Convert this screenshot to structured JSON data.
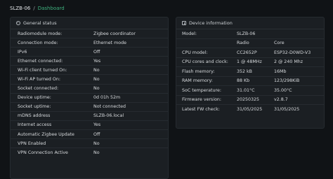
{
  "breadcrumb": {
    "home": "SLZB-06",
    "separator": "/",
    "current": "Dashboard"
  },
  "status_card": {
    "title": "General status",
    "rows": [
      {
        "key": "Radiomodule mode:",
        "value": "Zigbee coordinator"
      },
      {
        "key": "Connection mode:",
        "value": "Ethernet mode"
      },
      {
        "key": "IPv6",
        "value": "Off"
      },
      {
        "key": "Ethernet connected:",
        "value": "Yes"
      },
      {
        "key": "Wi-Fi client turned On:",
        "value": "No"
      },
      {
        "key": "Wi-Fi AP turned On:",
        "value": "No"
      },
      {
        "key": "Socket connected:",
        "value": "No"
      },
      {
        "key": "Device uptime:",
        "value": "0d 01h 52m"
      },
      {
        "key": "Socket uptime:",
        "value": "Not connected"
      },
      {
        "key": "mDNS address",
        "value": "SLZB-06.local"
      },
      {
        "key": "Internet access",
        "value": "Yes"
      },
      {
        "key": "Automatic Zigbee Update",
        "value": "Off"
      },
      {
        "key": "VPN Enabled",
        "value": "No"
      },
      {
        "key": "VPN Connection Active",
        "value": "No"
      }
    ]
  },
  "device_card": {
    "title": "Device information",
    "rows": [
      {
        "key": "Model:",
        "c1": "SLZB-06",
        "c2": ""
      },
      {
        "key": "",
        "c1": "Radio",
        "c2": "Core"
      },
      {
        "key": "CPU model:",
        "c1": "CC2652P",
        "c2": "ESP32-D0WD-V3"
      },
      {
        "key": "CPU cores and clock:",
        "c1": "1 @ 48MHz",
        "c2": "2 @ 240 Mhz"
      },
      {
        "key": "Flash memory:",
        "c1": "352 kB",
        "c2": "16Mb"
      },
      {
        "key": "RAM memory:",
        "c1": "88 Kb",
        "c2": "123/298KiB"
      },
      {
        "key": "SoC temperature:",
        "c1": "31.01°C",
        "c2": "35.00°C"
      },
      {
        "key": "Firmware version:",
        "c1": "20250325",
        "c2": "v2.8.7"
      },
      {
        "key": "Latest FW check:",
        "c1": "31/05/2025",
        "c2": "31/05/2025"
      }
    ]
  }
}
